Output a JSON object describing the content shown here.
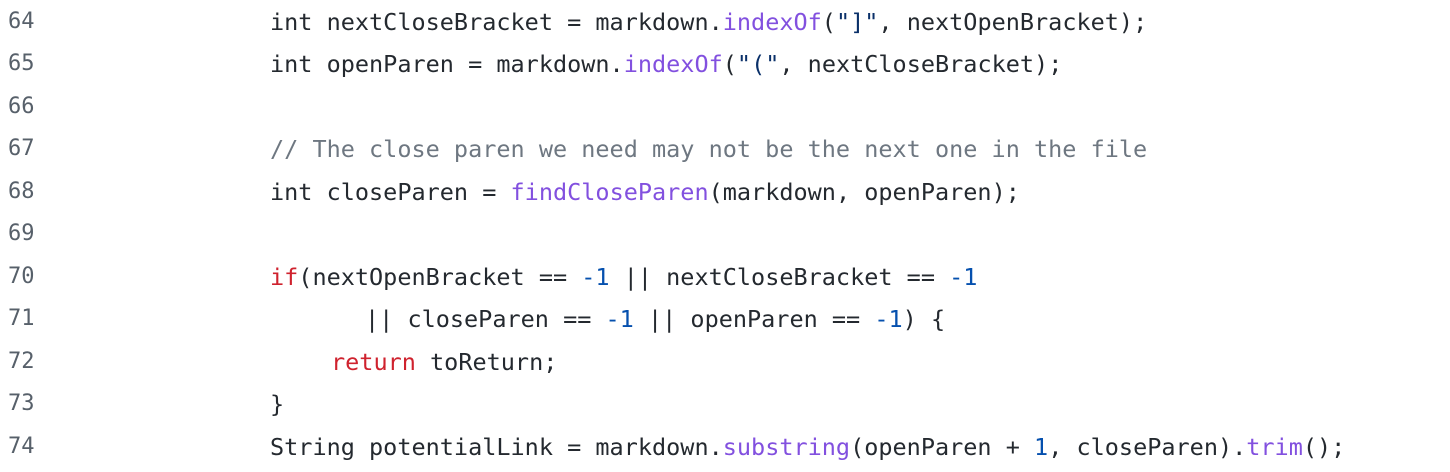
{
  "theme": {
    "background": "#ffffff",
    "line_number_color": "#57606a",
    "text_color": "#24292f",
    "keyword_color": "#cf222e",
    "method_color": "#8250df",
    "string_color": "#0a3069",
    "number_color": "#0550ae",
    "comment_color": "#6e7781"
  },
  "code": {
    "lines": [
      {
        "number": "64",
        "tokens": [
          {
            "text": "int nextCloseBracket = markdown.",
            "type": "text"
          },
          {
            "text": "indexOf",
            "type": "method"
          },
          {
            "text": "(",
            "type": "text"
          },
          {
            "text": "\"]\"",
            "type": "string"
          },
          {
            "text": ", nextOpenBracket);",
            "type": "text"
          }
        ]
      },
      {
        "number": "65",
        "tokens": [
          {
            "text": "int openParen = markdown.",
            "type": "text"
          },
          {
            "text": "indexOf",
            "type": "method"
          },
          {
            "text": "(",
            "type": "text"
          },
          {
            "text": "\"(\"",
            "type": "string"
          },
          {
            "text": ", nextCloseBracket);",
            "type": "text"
          }
        ]
      },
      {
        "number": "66",
        "tokens": []
      },
      {
        "number": "67",
        "tokens": [
          {
            "text": "// The close paren we need may not be the next one in the file",
            "type": "comment"
          }
        ]
      },
      {
        "number": "68",
        "tokens": [
          {
            "text": "int closeParen = ",
            "type": "text"
          },
          {
            "text": "findCloseParen",
            "type": "method"
          },
          {
            "text": "(markdown, openParen);",
            "type": "text"
          }
        ]
      },
      {
        "number": "69",
        "tokens": []
      },
      {
        "number": "70",
        "tokens": [
          {
            "text": "if",
            "type": "keyword"
          },
          {
            "text": "(nextOpenBracket == ",
            "type": "text"
          },
          {
            "text": "-1",
            "type": "number"
          },
          {
            "text": " || nextCloseBracket == ",
            "type": "text"
          },
          {
            "text": "-1",
            "type": "number"
          }
        ]
      },
      {
        "number": "71",
        "tokens": [
          {
            "text": "|| closeParen == ",
            "type": "text"
          },
          {
            "text": "-1",
            "type": "number"
          },
          {
            "text": " || openParen == ",
            "type": "text"
          },
          {
            "text": "-1",
            "type": "number"
          },
          {
            "text": ") {",
            "type": "text"
          }
        ]
      },
      {
        "number": "72",
        "tokens": [
          {
            "text": "return",
            "type": "keyword"
          },
          {
            "text": " toReturn;",
            "type": "text"
          }
        ]
      },
      {
        "number": "73",
        "tokens": [
          {
            "text": "}",
            "type": "text"
          }
        ]
      },
      {
        "number": "74",
        "tokens": [
          {
            "text": "String potentialLink = markdown.",
            "type": "text"
          },
          {
            "text": "substring",
            "type": "method"
          },
          {
            "text": "(openParen + ",
            "type": "text"
          },
          {
            "text": "1",
            "type": "number"
          },
          {
            "text": ", closeParen).",
            "type": "text"
          },
          {
            "text": "trim",
            "type": "method"
          },
          {
            "text": "();",
            "type": "text"
          }
        ]
      }
    ]
  }
}
